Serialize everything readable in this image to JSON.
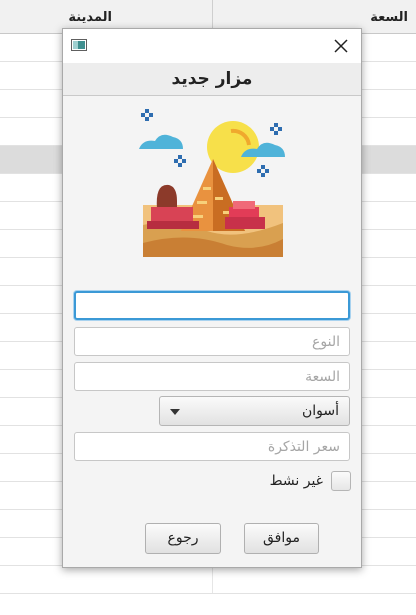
{
  "background_table": {
    "columns": [
      "السعة",
      "المدينة"
    ],
    "row_count": 20,
    "selected_row_index": 4
  },
  "dialog": {
    "title": "مزار جديد",
    "illustration_icon": "pyramid-sphinx-desert",
    "fields": {
      "name": {
        "value": "",
        "placeholder": ""
      },
      "type": {
        "value": "",
        "placeholder": "النوع"
      },
      "capacity": {
        "value": "",
        "placeholder": "السعة"
      },
      "price": {
        "value": "",
        "placeholder": "سعر التذكرة"
      }
    },
    "city_select": {
      "selected": "أسوان"
    },
    "inactive_checkbox": {
      "label": "غير نشط",
      "checked": false
    },
    "buttons": {
      "ok": "موافق",
      "back": "رجوع"
    }
  },
  "colors": {
    "focus_border": "#3b99d6",
    "dialog_bg": "#f4f4f4",
    "selected_row": "#dcdcdc"
  }
}
